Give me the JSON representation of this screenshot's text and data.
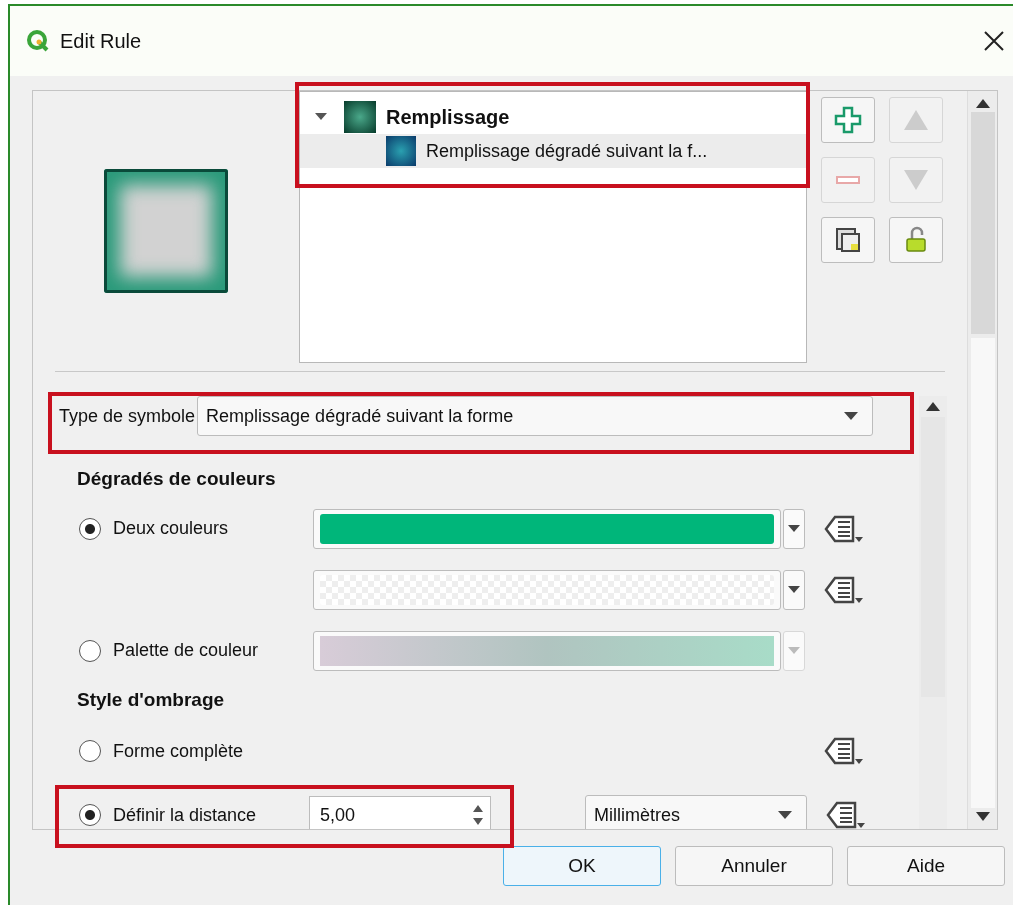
{
  "window": {
    "title": "Edit Rule"
  },
  "symbol_tree": {
    "highlighted": true,
    "items": [
      {
        "label": "Remplissage",
        "expanded": true,
        "selected": false,
        "children": [
          {
            "label": "Remplissage dégradé suivant la f...",
            "selected": true
          }
        ]
      }
    ]
  },
  "tool_buttons": [
    {
      "kind": "add",
      "disabled": false
    },
    {
      "kind": "up",
      "disabled": true
    },
    {
      "kind": "remove",
      "disabled": true
    },
    {
      "kind": "down",
      "disabled": true
    },
    {
      "kind": "duplicate",
      "disabled": false
    },
    {
      "kind": "unlock",
      "disabled": false
    }
  ],
  "symbol_type": {
    "label": "Type de symbole",
    "value": "Remplissage dégradé suivant la forme",
    "highlighted": true
  },
  "gradient_colors": {
    "heading": "Dégradés de couleurs",
    "rows": [
      {
        "kind": "color",
        "radio": "Deux couleurs",
        "selected": true,
        "color": "#00b67a"
      },
      {
        "kind": "transparent"
      },
      {
        "kind": "ramp",
        "radio": "Palette de couleur",
        "selected": false,
        "disabled": true
      }
    ]
  },
  "shading": {
    "heading": "Style d'ombrage",
    "rows": [
      {
        "kind": "plain",
        "radio": "Forme complète",
        "selected": false
      },
      {
        "kind": "distance",
        "radio": "Définir la distance",
        "selected": true,
        "value": "5,00",
        "unit": "Millimètres",
        "highlighted": true
      }
    ]
  },
  "buttons": [
    {
      "label": "OK",
      "default": true
    },
    {
      "label": "Annuler",
      "default": false
    },
    {
      "label": "Aide",
      "default": false
    }
  ]
}
